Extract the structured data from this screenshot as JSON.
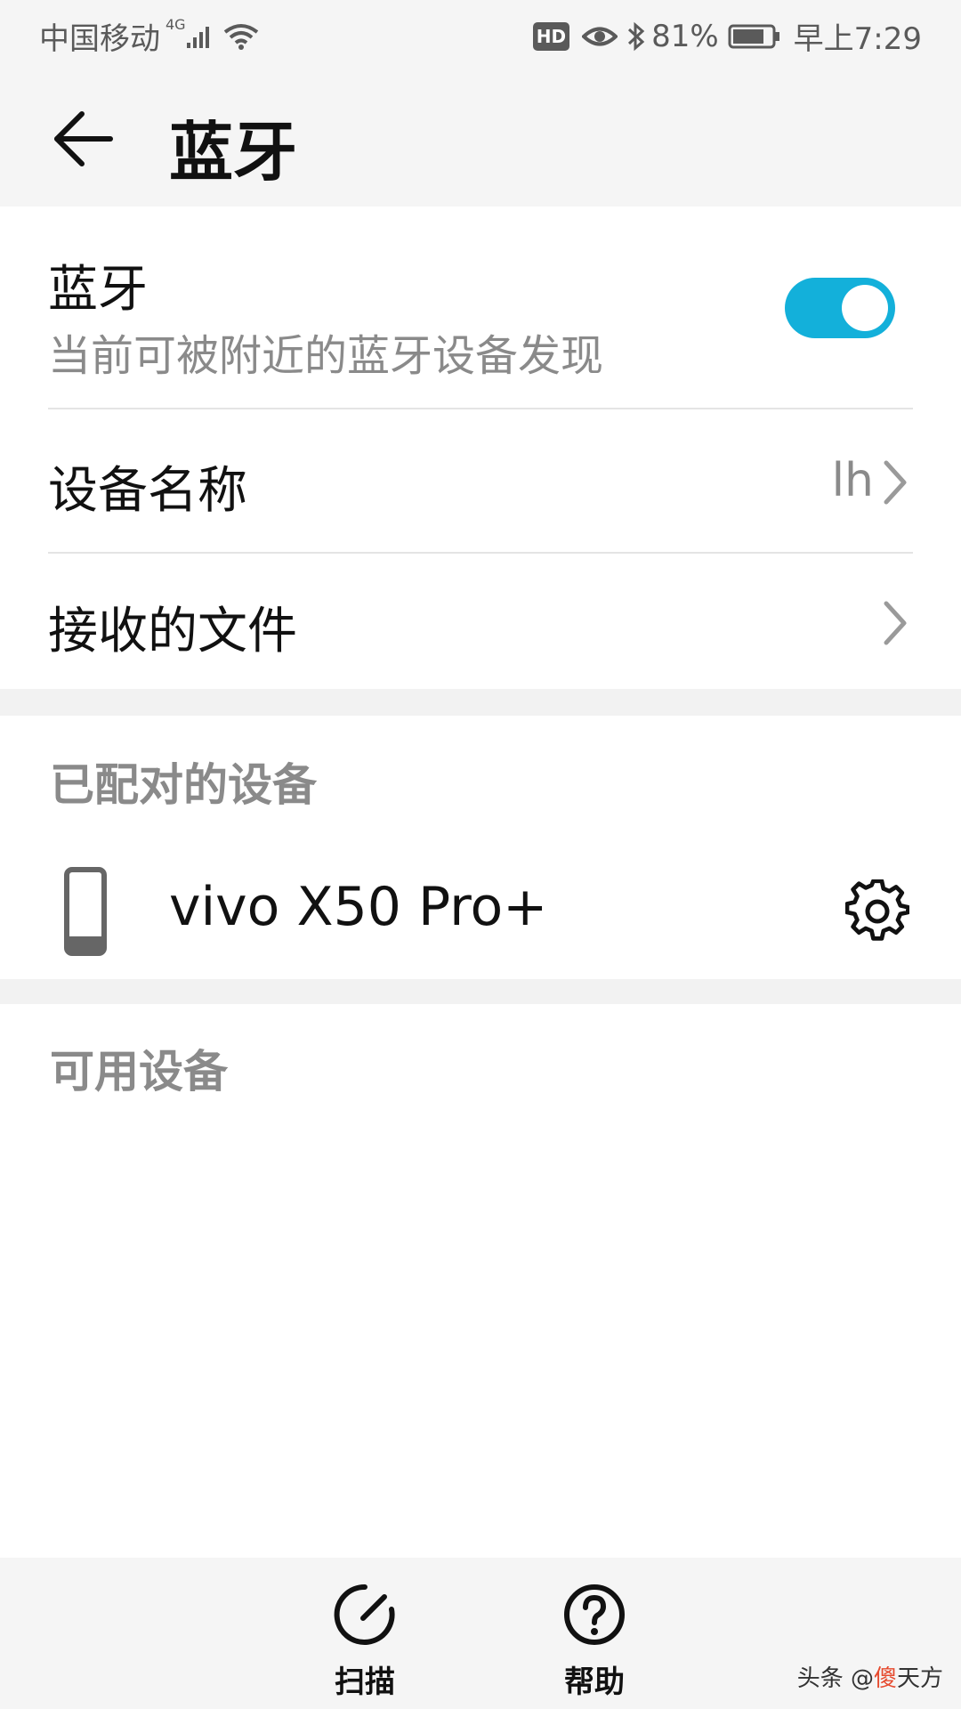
{
  "status_bar": {
    "carrier": "中国移动",
    "network": "4G",
    "battery": "81%",
    "battery_level": 0.81,
    "time": "早上7:29",
    "hd_badge": "HD",
    "icons": [
      "signal-icon",
      "wifi-icon",
      "hd-icon",
      "eye-icon",
      "bluetooth-icon",
      "battery-icon"
    ]
  },
  "app_bar": {
    "title": "蓝牙",
    "back_icon": "arrow-left-icon"
  },
  "bluetooth": {
    "title": "蓝牙",
    "subtitle": "当前可被附近的蓝牙设备发现",
    "enabled": true
  },
  "device_name": {
    "label": "设备名称",
    "value": "lh"
  },
  "received_files": {
    "label": "接收的文件"
  },
  "paired": {
    "header": "已配对的设备",
    "devices": [
      {
        "name": "vivo X50 Pro+",
        "icon": "phone-icon",
        "action_icon": "gear-icon"
      }
    ]
  },
  "available": {
    "header": "可用设备"
  },
  "bottom_bar": {
    "scan_label": "扫描",
    "help_label": "帮助"
  },
  "watermark": {
    "prefix": "头条 @",
    "accent": "傻",
    "suffix": "天方"
  },
  "colors": {
    "accent": "#13b0da",
    "background": "#f5f5f5"
  }
}
